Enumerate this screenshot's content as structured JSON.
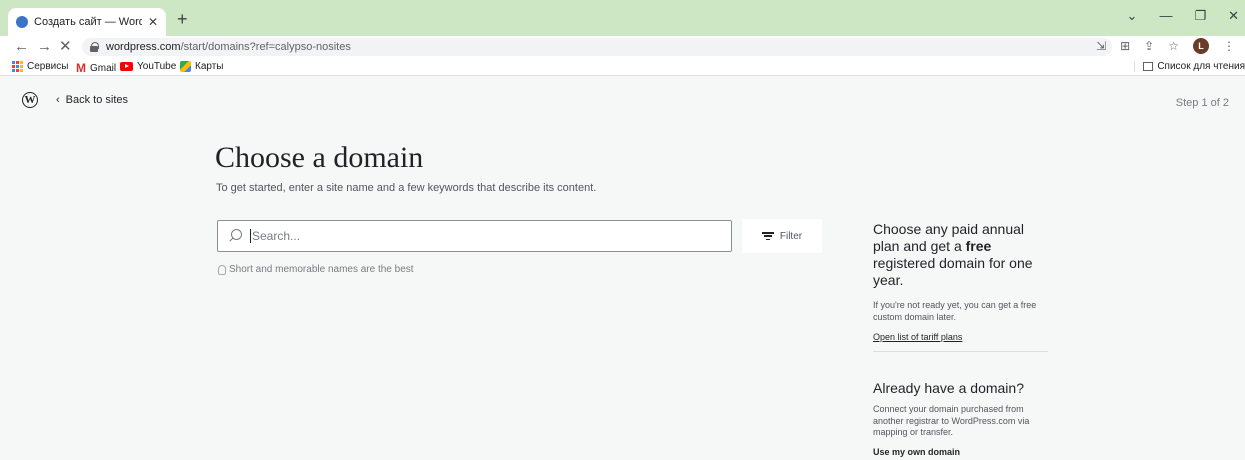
{
  "browser": {
    "tab_title": "Создать сайт — WordPress.com",
    "tab_close": "✕",
    "new_tab": "+",
    "url_host": "wordpress.com",
    "url_path": "/start/domains?ref=calypso-nosites",
    "bookmarks": [
      {
        "label": "Сервисы"
      },
      {
        "label": "Gmail"
      },
      {
        "label": "YouTube"
      },
      {
        "label": "Карты"
      }
    ],
    "reading_list": "Список для чтения",
    "profile_initial": "L"
  },
  "header": {
    "logo": "W",
    "back_label": "Back to sites",
    "step": "Step 1 of 2"
  },
  "main": {
    "title": "Choose a domain",
    "subtitle": "To get started, enter a site name and a few keywords that describe its content.",
    "search_placeholder": "Search...",
    "filter_label": "Filter",
    "hint": "Short and memorable names are the best"
  },
  "sidebar": {
    "promo_title_pre": "Choose any paid annual plan and get a ",
    "promo_title_bold": "free",
    "promo_title_post": " registered domain for one year.",
    "promo_text": "If you're not ready yet, you can get a free custom domain later.",
    "promo_link": "Open list of tariff plans",
    "own_title": "Already have a domain?",
    "own_text": "Connect your domain purchased from another registrar to WordPress.com via mapping or transfer.",
    "own_link": "Use my own domain"
  }
}
